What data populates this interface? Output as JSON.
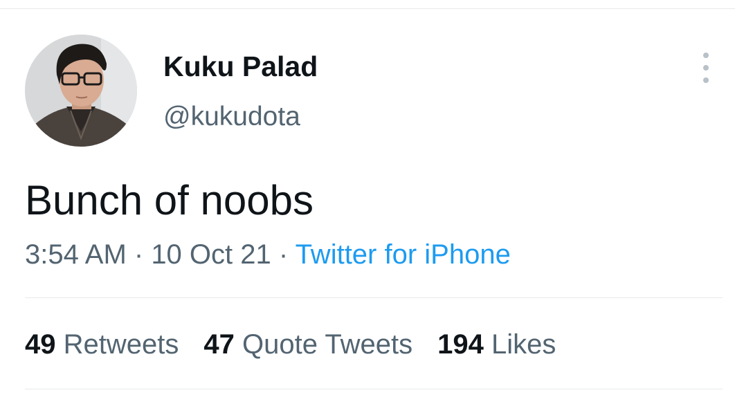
{
  "user": {
    "display_name": "Kuku Palad",
    "handle": "@kukudota"
  },
  "tweet": {
    "text": "Bunch of noobs",
    "time": "3:54 AM",
    "separator": " · ",
    "date": "10 Oct 21",
    "source": "Twitter for iPhone"
  },
  "stats": {
    "retweets": {
      "count": "49",
      "label": "Retweets"
    },
    "quote_tweets": {
      "count": "47",
      "label": "Quote Tweets"
    },
    "likes": {
      "count": "194",
      "label": "Likes"
    }
  },
  "colors": {
    "primary_text": "#0f1419",
    "secondary_text": "#536471",
    "link": "#1d9bf0",
    "divider": "#e6e9eb"
  },
  "icons": {
    "more": "more-vertical-icon"
  }
}
